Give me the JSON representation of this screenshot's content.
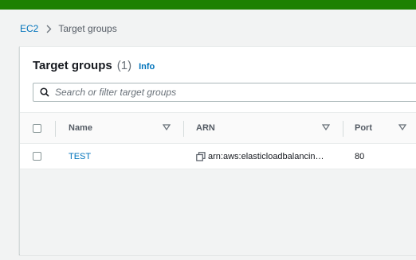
{
  "breadcrumb": {
    "root": "EC2",
    "current": "Target groups"
  },
  "panel": {
    "title": "Target groups",
    "count": "(1)",
    "info": "Info",
    "search_placeholder": "Search or filter target groups"
  },
  "table": {
    "columns": [
      {
        "label": "Name"
      },
      {
        "label": "ARN"
      },
      {
        "label": "Port"
      }
    ],
    "rows": [
      {
        "name": "TEST",
        "arn": "arn:aws:elasticloadbalancin…",
        "port": "80"
      }
    ]
  },
  "colors": {
    "accent": "#1d8102",
    "link": "#0073bb"
  },
  "icons": {
    "separator": "chevron-right-icon",
    "search": "search-icon",
    "sort": "caret-down-icon",
    "copy": "copy-icon"
  }
}
